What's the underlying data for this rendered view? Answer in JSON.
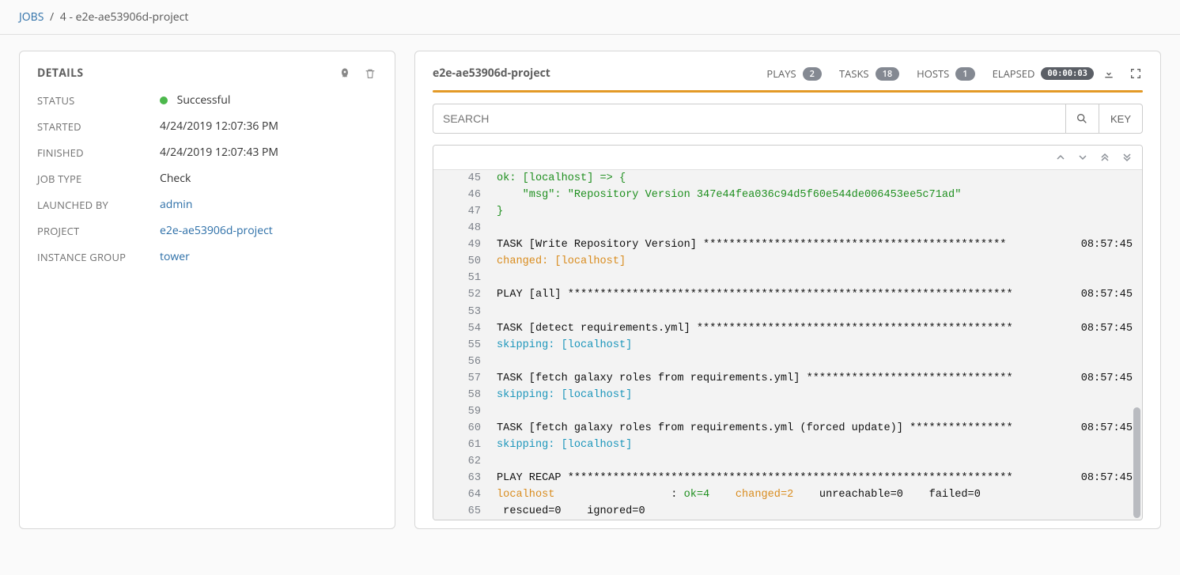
{
  "breadcrumb": {
    "root": "JOBS",
    "sep": "/",
    "leaf": "4 - e2e-ae53906d-project"
  },
  "details": {
    "title": "DETAILS",
    "rows": {
      "status_label": "STATUS",
      "status_value": "Successful",
      "status_color": "#4CB84C",
      "started_label": "STARTED",
      "started_value": "4/24/2019 12:07:36 PM",
      "finished_label": "FINISHED",
      "finished_value": "4/24/2019 12:07:43 PM",
      "jobtype_label": "JOB TYPE",
      "jobtype_value": "Check",
      "launched_label": "LAUNCHED BY",
      "launched_value": "admin",
      "project_label": "PROJECT",
      "project_value": "e2e-ae53906d-project",
      "igroup_label": "INSTANCE GROUP",
      "igroup_value": "tower"
    }
  },
  "output": {
    "title": "e2e-ae53906d-project",
    "stats": {
      "plays_label": "PLAYS",
      "plays": "2",
      "tasks_label": "TASKS",
      "tasks": "18",
      "hosts_label": "HOSTS",
      "hosts": "1",
      "elapsed_label": "ELAPSED",
      "elapsed": "00:00:03"
    },
    "search_placeholder": "SEARCH",
    "key_label": "KEY",
    "lines": [
      {
        "n": "45",
        "ts": "",
        "cls": "c-ok",
        "t": "ok: [localhost] => {"
      },
      {
        "n": "46",
        "ts": "",
        "cls": "c-ok",
        "t": "    \"msg\": \"Repository Version 347e44fea036c94d5f60e544de006453ee5c71ad\""
      },
      {
        "n": "47",
        "ts": "",
        "cls": "c-ok",
        "t": "}"
      },
      {
        "n": "48",
        "ts": "",
        "cls": "",
        "t": ""
      },
      {
        "n": "49",
        "ts": "08:57:45",
        "cls": "",
        "t": "TASK [Write Repository Version] ***********************************************"
      },
      {
        "n": "50",
        "ts": "",
        "cls": "c-changed",
        "t": "changed: [localhost]"
      },
      {
        "n": "51",
        "ts": "",
        "cls": "",
        "t": ""
      },
      {
        "n": "52",
        "ts": "08:57:45",
        "cls": "",
        "t": "PLAY [all] *********************************************************************"
      },
      {
        "n": "53",
        "ts": "",
        "cls": "",
        "t": ""
      },
      {
        "n": "54",
        "ts": "08:57:45",
        "cls": "",
        "t": "TASK [detect requirements.yml] *************************************************"
      },
      {
        "n": "55",
        "ts": "",
        "cls": "c-skip",
        "t": "skipping: [localhost]"
      },
      {
        "n": "56",
        "ts": "",
        "cls": "",
        "t": ""
      },
      {
        "n": "57",
        "ts": "08:57:45",
        "cls": "",
        "t": "TASK [fetch galaxy roles from requirements.yml] ********************************"
      },
      {
        "n": "58",
        "ts": "",
        "cls": "c-skip",
        "t": "skipping: [localhost]"
      },
      {
        "n": "59",
        "ts": "",
        "cls": "",
        "t": ""
      },
      {
        "n": "60",
        "ts": "08:57:45",
        "cls": "",
        "t": "TASK [fetch galaxy roles from requirements.yml (forced update)] ****************"
      },
      {
        "n": "61",
        "ts": "",
        "cls": "c-skip",
        "t": "skipping: [localhost]"
      },
      {
        "n": "62",
        "ts": "",
        "cls": "",
        "t": ""
      },
      {
        "n": "63",
        "ts": "08:57:45",
        "cls": "",
        "t": "PLAY RECAP *********************************************************************"
      },
      {
        "n": "65",
        "ts": "",
        "cls": "",
        "t": " rescued=0    ignored=0"
      }
    ],
    "recap": {
      "n": "64",
      "host": "localhost",
      "pad": "                  : ",
      "ok": "ok=4",
      "sp1": "    ",
      "changed": "changed=2",
      "sp2": "    ",
      "rest": "unreachable=0    failed=0   "
    }
  }
}
